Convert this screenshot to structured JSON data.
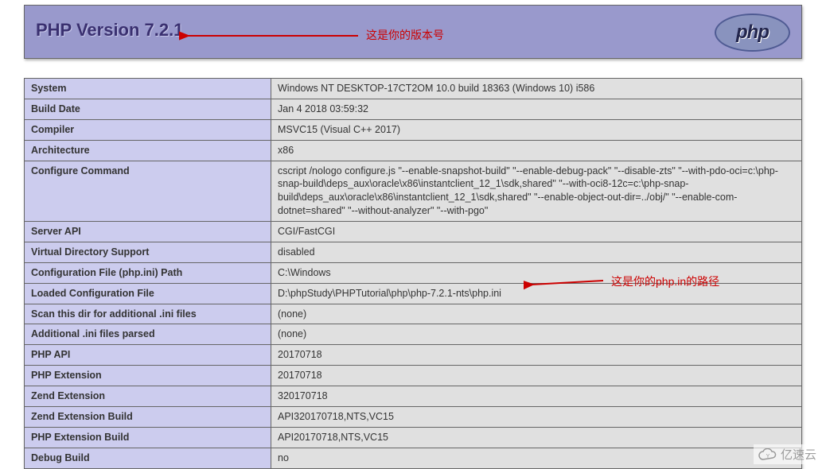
{
  "header": {
    "title": "PHP Version 7.2.1"
  },
  "annotations": {
    "version_note": "这是你的版本号",
    "path_note": "这是你的php.in的路径"
  },
  "rows": [
    {
      "label": "System",
      "value": "Windows NT DESKTOP-17CT2OM 10.0 build 18363 (Windows 10) i586"
    },
    {
      "label": "Build Date",
      "value": "Jan 4 2018 03:59:32"
    },
    {
      "label": "Compiler",
      "value": "MSVC15 (Visual C++ 2017)"
    },
    {
      "label": "Architecture",
      "value": "x86"
    },
    {
      "label": "Configure Command",
      "value": "cscript /nologo configure.js \"--enable-snapshot-build\" \"--enable-debug-pack\" \"--disable-zts\" \"--with-pdo-oci=c:\\php-snap-build\\deps_aux\\oracle\\x86\\instantclient_12_1\\sdk,shared\" \"--with-oci8-12c=c:\\php-snap-build\\deps_aux\\oracle\\x86\\instantclient_12_1\\sdk,shared\" \"--enable-object-out-dir=../obj/\" \"--enable-com-dotnet=shared\" \"--without-analyzer\" \"--with-pgo\""
    },
    {
      "label": "Server API",
      "value": "CGI/FastCGI"
    },
    {
      "label": "Virtual Directory Support",
      "value": "disabled"
    },
    {
      "label": "Configuration File (php.ini) Path",
      "value": "C:\\Windows"
    },
    {
      "label": "Loaded Configuration File",
      "value": "D:\\phpStudy\\PHPTutorial\\php\\php-7.2.1-nts\\php.ini"
    },
    {
      "label": "Scan this dir for additional .ini files",
      "value": "(none)"
    },
    {
      "label": "Additional .ini files parsed",
      "value": "(none)"
    },
    {
      "label": "PHP API",
      "value": "20170718"
    },
    {
      "label": "PHP Extension",
      "value": "20170718"
    },
    {
      "label": "Zend Extension",
      "value": "320170718"
    },
    {
      "label": "Zend Extension Build",
      "value": "API320170718,NTS,VC15"
    },
    {
      "label": "PHP Extension Build",
      "value": "API20170718,NTS,VC15"
    },
    {
      "label": "Debug Build",
      "value": "no"
    }
  ],
  "watermark": "亿速云"
}
